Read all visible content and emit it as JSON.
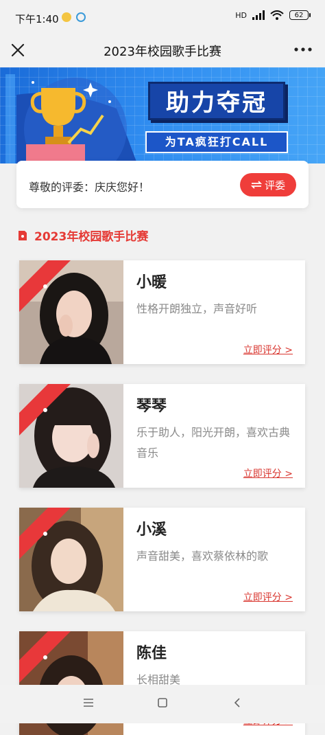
{
  "status": {
    "time": "下午1:40",
    "network": "HD",
    "battery": "62"
  },
  "nav": {
    "title": "2023年校园歌手比赛",
    "close_icon": "close-icon",
    "more_icon": "more-icon"
  },
  "banner": {
    "headline": "助力夺冠",
    "subline": "为TA疯狂打CALL",
    "icon": "trophy-icon"
  },
  "greeting": {
    "text": "尊敬的评委：庆庆您好！",
    "judge_button": "评委",
    "judge_icon": "swap-arrows-icon"
  },
  "section": {
    "title": "2023年校园歌手比赛",
    "icon": "bookmark-icon"
  },
  "contestants": [
    {
      "name": "小暖",
      "desc": "性格开朗独立，声音好听",
      "action": "立即评分 >"
    },
    {
      "name": "琴琴",
      "desc": "乐于助人，阳光开朗，喜欢古典音乐",
      "action": "立即评分 >"
    },
    {
      "name": "小溪",
      "desc": "声音甜美，喜欢蔡依林的歌",
      "action": "立即评分 >"
    },
    {
      "name": "陈佳",
      "desc": "长相甜美",
      "action": "立即评分 >"
    }
  ],
  "colors": {
    "accent": "#ef3d3a",
    "banner": "#2f8cf0"
  }
}
